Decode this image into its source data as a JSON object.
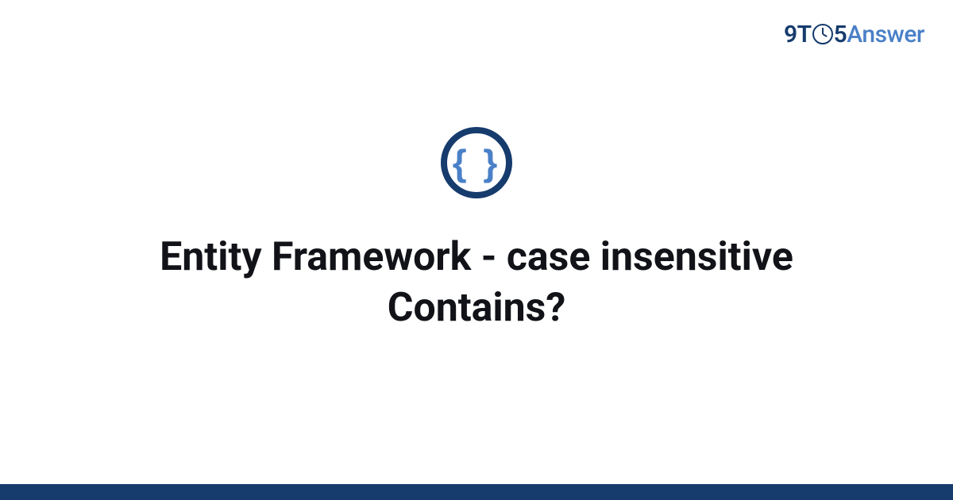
{
  "brand": {
    "prefix": "9T",
    "middle": "5",
    "suffix": "Answer"
  },
  "icon": {
    "name": "code-braces-icon",
    "glyph": "{ }"
  },
  "title": "Entity Framework - case insensitive Contains?",
  "colors": {
    "primary": "#163b6d",
    "accent": "#4a80c7"
  }
}
